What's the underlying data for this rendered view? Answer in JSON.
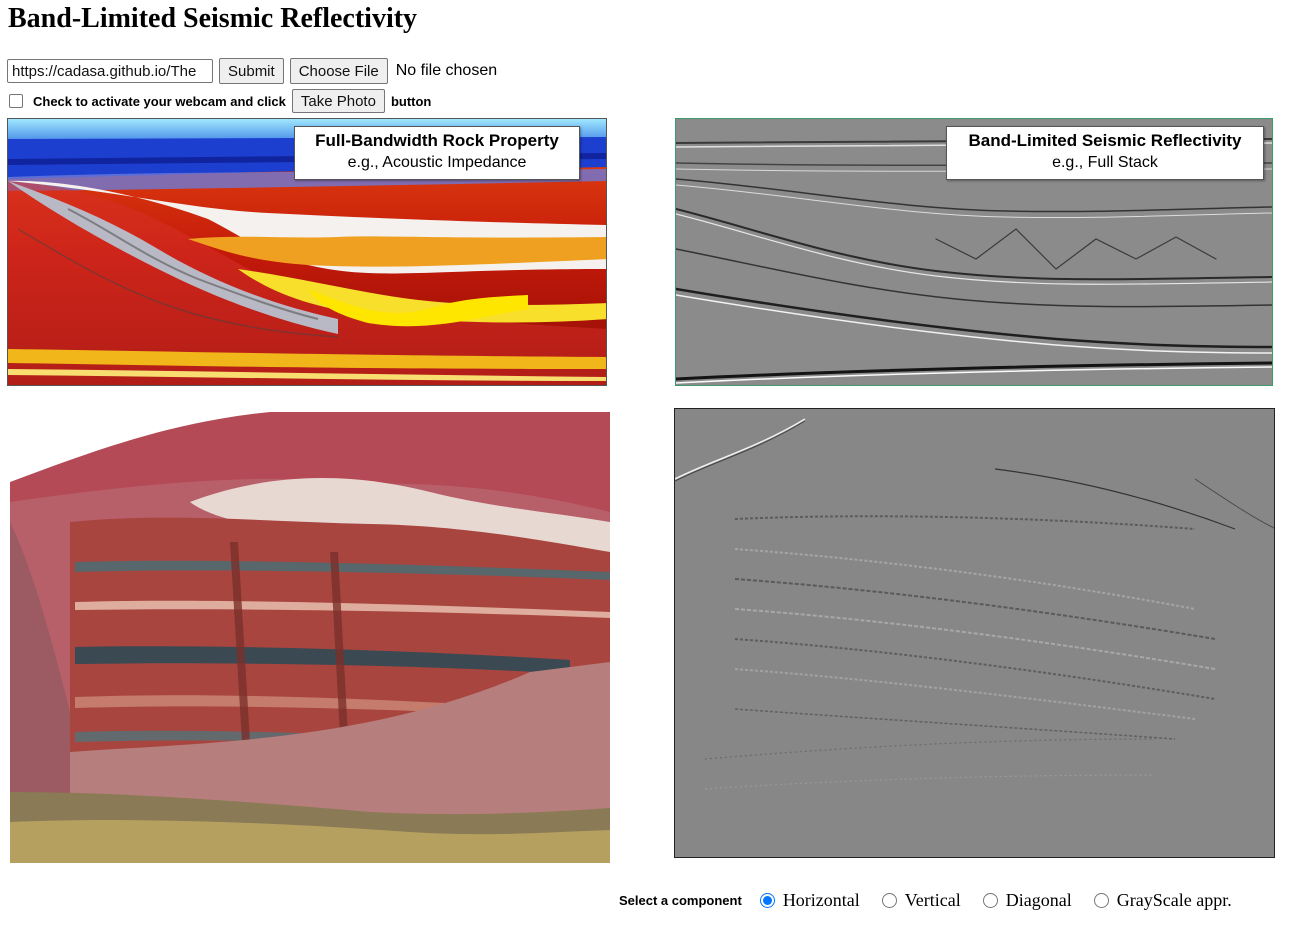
{
  "page": {
    "title": "Band-Limited Seismic Reflectivity"
  },
  "controls": {
    "url_value": "https://cadasa.github.io/The",
    "submit_label": "Submit",
    "choose_file_label": "Choose File",
    "no_file_text": "No file chosen",
    "webcam_text_before": "Check to activate your webcam and click",
    "take_photo_label": "Take Photo",
    "webcam_text_after": "button"
  },
  "panels": {
    "left_top": {
      "title": "Full-Bandwidth Rock Property",
      "subtitle": "e.g., Acoustic Impedance"
    },
    "right_top": {
      "title": "Band-Limited Seismic Reflectivity",
      "subtitle": "e.g., Full Stack"
    }
  },
  "component_selector": {
    "label": "Select a component",
    "options": [
      "Horizontal",
      "Vertical",
      "Diagonal",
      "GrayScale appr."
    ],
    "selected": "Horizontal"
  },
  "colors": {
    "radio_accent": "#0075ff",
    "seismic_gray": "#8a8a8a"
  }
}
